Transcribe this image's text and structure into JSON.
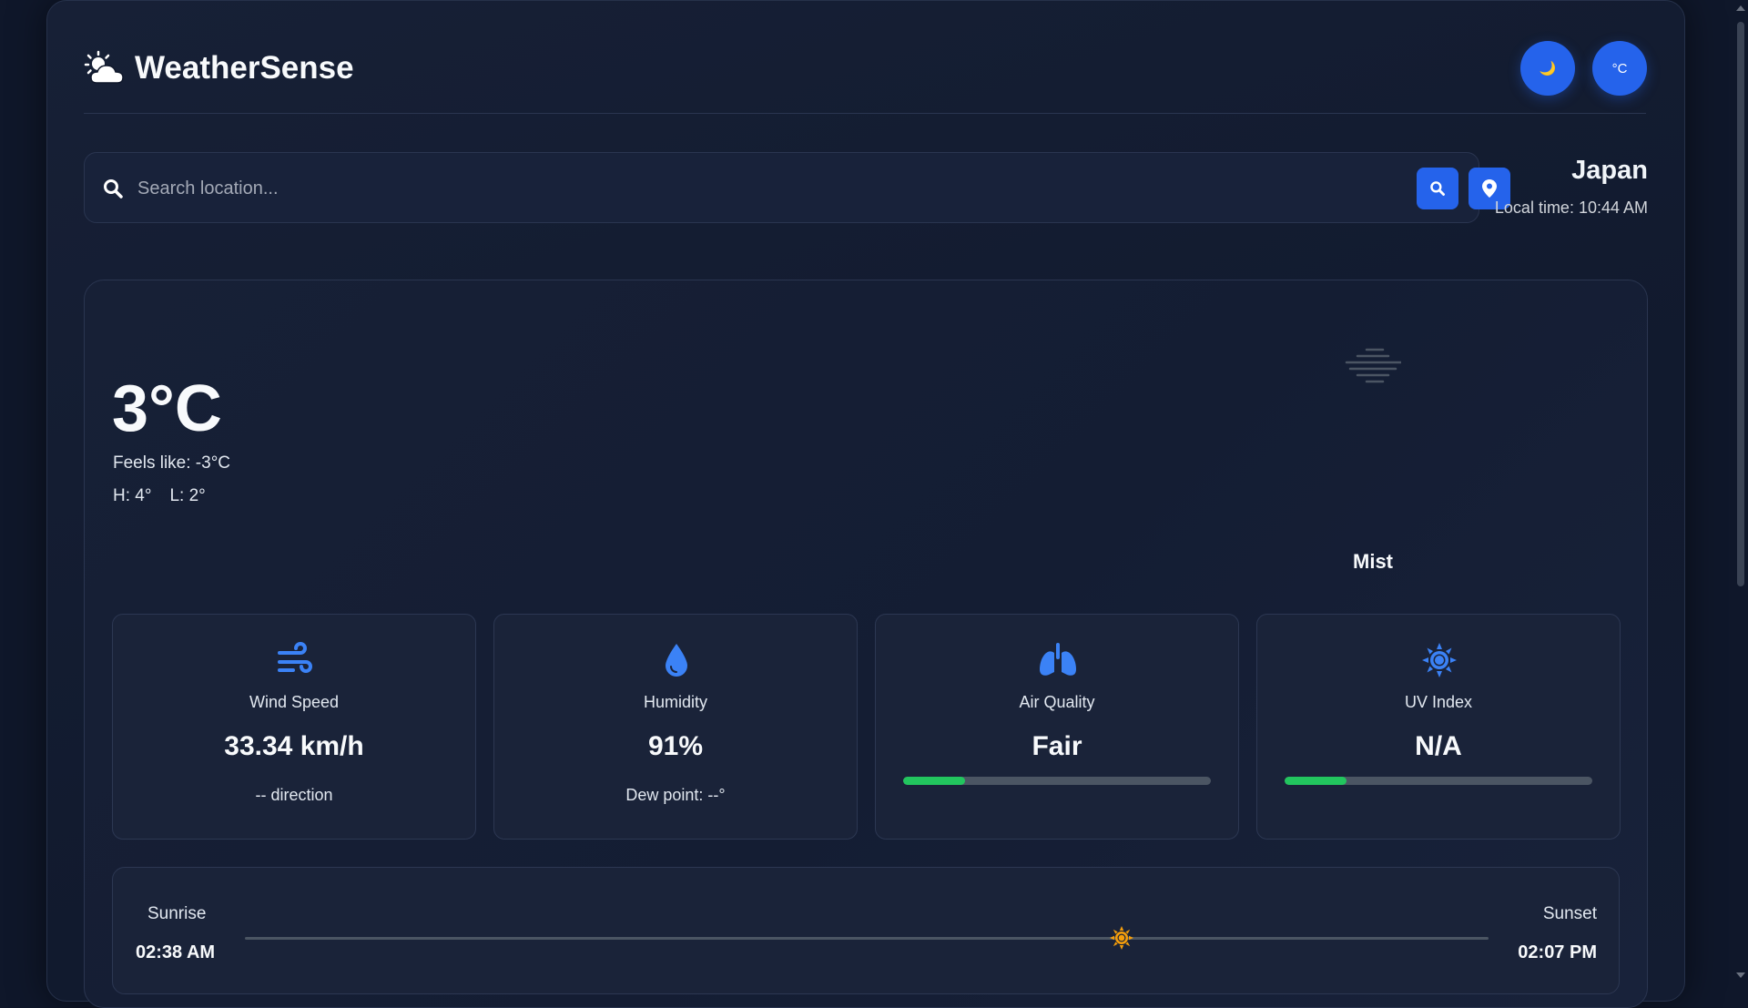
{
  "header": {
    "app_name": "WeatherSense",
    "theme_toggle_label": "🌙",
    "unit_toggle_label": "°C"
  },
  "search": {
    "placeholder": "Search location...",
    "value": ""
  },
  "location": {
    "name": "Japan",
    "local_time": "Local time: 10:44 AM"
  },
  "current": {
    "temperature": "3°C",
    "feels_like": "Feels like: -3°C",
    "high": "H: 4°",
    "low": "L: 2°",
    "condition": "Mist",
    "condition_icon": "mist-icon"
  },
  "metrics": [
    {
      "label": "Wind Speed",
      "value": "33.34 km/h",
      "sub": "-- direction",
      "icon": "wind-icon"
    },
    {
      "label": "Humidity",
      "value": "91%",
      "sub": "Dew point: --°",
      "icon": "droplet-icon"
    },
    {
      "label": "Air Quality",
      "value": "Fair",
      "level_fraction": 0.2,
      "icon": "lungs-icon"
    },
    {
      "label": "UV Index",
      "value": "N/A",
      "level_fraction": 0.2,
      "icon": "sun-icon"
    }
  ],
  "sun": {
    "sunrise_label": "Sunrise",
    "sunrise_time": "02:38 AM",
    "sunset_label": "Sunset",
    "sunset_time": "02:07 PM",
    "progress_fraction": 0.705
  },
  "colors": {
    "accent": "#2563eb",
    "icon_blue": "#3b82f6",
    "bar_fill": "#22c55e",
    "sun_marker": "#f59e0b"
  }
}
